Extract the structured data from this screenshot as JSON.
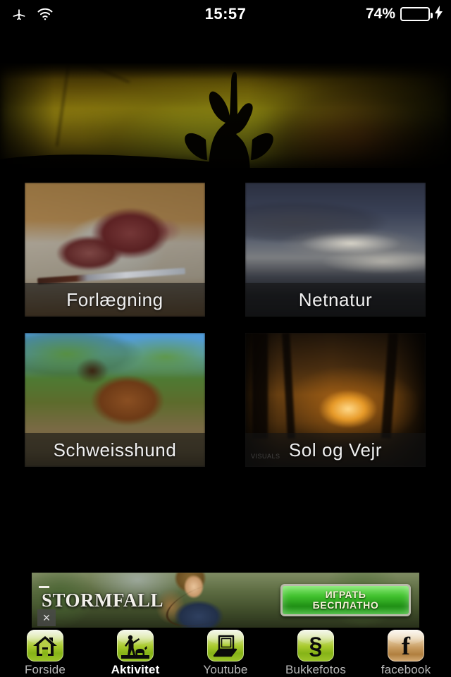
{
  "statusbar": {
    "airplane_icon": "airplane-icon",
    "wifi_icon": "wifi-icon",
    "time": "15:57",
    "battery_percent": "74%",
    "battery_level": 74,
    "charging_icon": "lightning-bolt-icon",
    "battery_color": "#49d54a"
  },
  "hero": {
    "alt": "roe-deer-silhouette-at-sunset"
  },
  "grid": {
    "tiles": [
      {
        "label": "Forlægning",
        "name": "tile-forlaegning",
        "image": "venison-meat-on-cutting-board"
      },
      {
        "label": "Netnatur",
        "name": "tile-netnatur",
        "image": "clouds-over-sea"
      },
      {
        "label": "Schweisshund",
        "name": "tile-schweisshund",
        "image": "tracking-dog-in-forest"
      },
      {
        "label": "Sol og Vejr",
        "name": "tile-sol-og-vejr",
        "image": "sunset-through-trees",
        "watermark": "VISUALS"
      }
    ]
  },
  "ad": {
    "brand": "TORMFALL",
    "brand_initial": "S",
    "cta_line1": "ИГРАТЬ",
    "cta_line2": "БЕСПЛАТНО",
    "close_label": "×",
    "cta_color": "#3fbf2c"
  },
  "tabbar": {
    "items": [
      {
        "label": "Forside",
        "icon": "home-icon",
        "active": false
      },
      {
        "label": "Aktivitet",
        "icon": "hunter-with-dog-icon",
        "active": true
      },
      {
        "label": "Youtube",
        "icon": "laptop-icon",
        "active": false
      },
      {
        "label": "Bukkefotos",
        "icon": "section-sign-icon",
        "active": false
      },
      {
        "label": "facebook",
        "icon": "facebook-f-icon",
        "active": false
      }
    ]
  }
}
